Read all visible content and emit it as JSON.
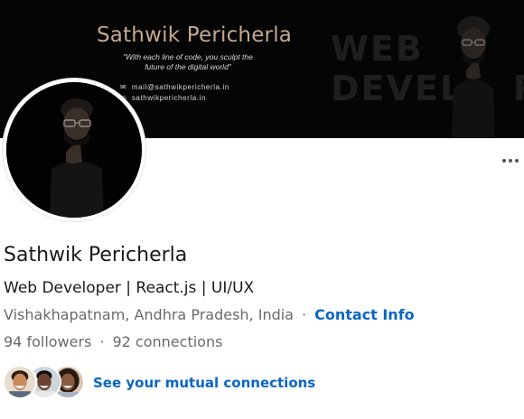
{
  "banner": {
    "name": "Sathwik Pericherla",
    "quote_line1": "\"With each line of code, you sculpt the",
    "quote_line2": "future of the digital world\"",
    "email": "mail@sathwikpericherla.in",
    "website": "sathwikpericherla.in",
    "big_line1": "WEB",
    "big_line2": "DEVEL",
    "big_line3": "R",
    "email_icon": "envelope-icon",
    "web_icon": "globe-icon"
  },
  "profile": {
    "name": "Sathwik Pericherla",
    "headline": "Web Developer | React.js | UI/UX",
    "location": "Vishakhapatnam, Andhra Pradesh, India",
    "separator": "·",
    "contact_info": "Contact Info",
    "followers": "94 followers",
    "connections": "92 connections",
    "mutual_link": "See your mutual connections"
  },
  "actions": {
    "more_icon": "more-options-icon"
  },
  "colors": {
    "link": "#0a66c2",
    "banner_text": "#c2a98f",
    "muted_text": "#6a6a6a"
  }
}
